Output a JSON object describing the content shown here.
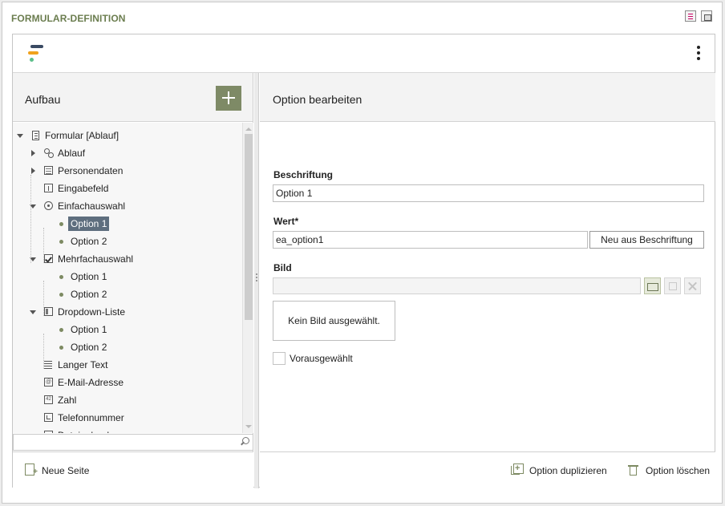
{
  "window": {
    "title": "FORMULAR-DEFINITION"
  },
  "left": {
    "title": "Aufbau",
    "footer": {
      "new_page": "Neue Seite"
    },
    "search": {
      "placeholder": ""
    }
  },
  "tree": [
    {
      "label": "Formular [Ablauf]",
      "icon": "form-icon",
      "level": 0,
      "toggle": "down"
    },
    {
      "label": "Ablauf",
      "icon": "workflow-icon",
      "level": 1,
      "toggle": "right"
    },
    {
      "label": "Personendaten",
      "icon": "table-icon",
      "level": 1,
      "toggle": "right"
    },
    {
      "label": "Eingabefeld",
      "icon": "input-field-icon",
      "level": 1,
      "toggle": "none"
    },
    {
      "label": "Einfachauswahl",
      "icon": "radio-icon",
      "level": 1,
      "toggle": "down"
    },
    {
      "label": "Option 1",
      "icon": "bullet-icon",
      "level": 2,
      "toggle": "none",
      "selected": true
    },
    {
      "label": "Option 2",
      "icon": "bullet-icon",
      "level": 2,
      "toggle": "none"
    },
    {
      "label": "Mehrfachauswahl",
      "icon": "checkbox-icon",
      "level": 1,
      "toggle": "down"
    },
    {
      "label": "Option 1",
      "icon": "bullet-icon",
      "level": 2,
      "toggle": "none"
    },
    {
      "label": "Option 2",
      "icon": "bullet-icon",
      "level": 2,
      "toggle": "none"
    },
    {
      "label": "Dropdown-Liste",
      "icon": "list-icon",
      "level": 1,
      "toggle": "down"
    },
    {
      "label": "Option 1",
      "icon": "bullet-icon",
      "level": 2,
      "toggle": "none"
    },
    {
      "label": "Option 2",
      "icon": "bullet-icon",
      "level": 2,
      "toggle": "none"
    },
    {
      "label": "Langer Text",
      "icon": "text-icon",
      "level": 1,
      "toggle": "none"
    },
    {
      "label": "E-Mail-Adresse",
      "icon": "email-icon",
      "level": 1,
      "toggle": "none"
    },
    {
      "label": "Zahl",
      "icon": "number-icon",
      "level": 1,
      "toggle": "none"
    },
    {
      "label": "Telefonnummer",
      "icon": "phone-icon",
      "level": 1,
      "toggle": "none"
    },
    {
      "label": "Dateiupload",
      "icon": "table-icon",
      "level": 1,
      "toggle": "none"
    }
  ],
  "right": {
    "title": "Option bearbeiten",
    "fields": {
      "beschriftung_label": "Beschriftung",
      "beschriftung_value": "Option 1",
      "wert_label": "Wert*",
      "wert_value": "ea_option1",
      "neu_button": "Neu aus Beschriftung",
      "bild_label": "Bild",
      "no_image": "Kein Bild ausgewählt.",
      "preselected_label": "Vorausgewählt"
    },
    "footer": {
      "duplicate": "Option duplizieren",
      "delete": "Option löschen"
    }
  },
  "colors": {
    "accent": "#7e8a66",
    "title_text": "#6b7d4f",
    "selection": "#5e6e7e"
  }
}
